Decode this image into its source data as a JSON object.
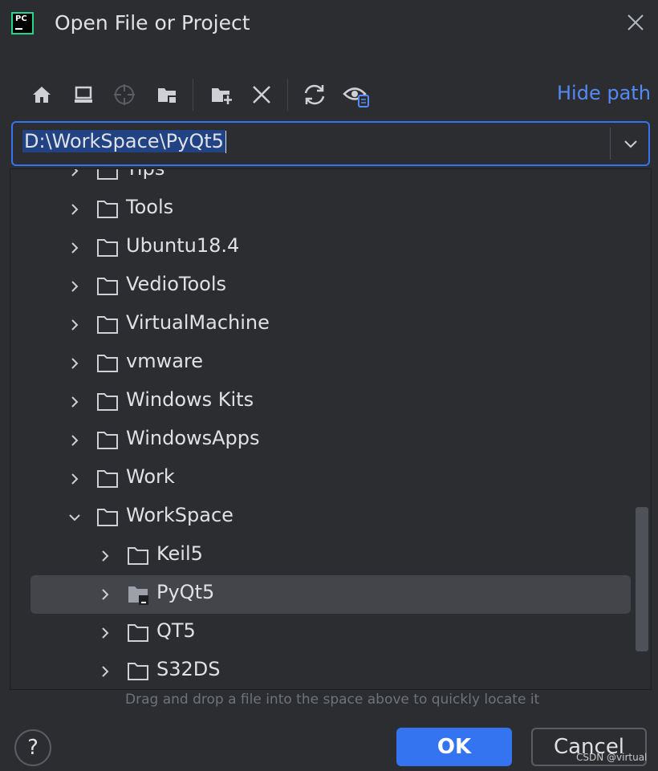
{
  "window": {
    "title": "Open File or Project",
    "app_logo_text": "PC"
  },
  "toolbar": {
    "hide_path_label": "Hide path"
  },
  "path": {
    "value": "D:\\WorkSpace\\PyQt5"
  },
  "tree": {
    "items": [
      {
        "name": "Tips",
        "expanded": false,
        "level": 0
      },
      {
        "name": "Tools",
        "expanded": false,
        "level": 0
      },
      {
        "name": "Ubuntu18.4",
        "expanded": false,
        "level": 0
      },
      {
        "name": "VedioTools",
        "expanded": false,
        "level": 0
      },
      {
        "name": "VirtualMachine",
        "expanded": false,
        "level": 0
      },
      {
        "name": "vmware",
        "expanded": false,
        "level": 0
      },
      {
        "name": "Windows Kits",
        "expanded": false,
        "level": 0
      },
      {
        "name": "WindowsApps",
        "expanded": false,
        "level": 0
      },
      {
        "name": "Work",
        "expanded": false,
        "level": 0
      },
      {
        "name": "WorkSpace",
        "expanded": true,
        "level": 0
      },
      {
        "name": "Keil5",
        "expanded": false,
        "level": 1
      },
      {
        "name": "PyQt5",
        "expanded": false,
        "level": 1,
        "selected": true
      },
      {
        "name": "QT5",
        "expanded": false,
        "level": 1
      },
      {
        "name": "S32DS",
        "expanded": false,
        "level": 1
      }
    ]
  },
  "hint": "Drag and drop a file into the space above to quickly locate it",
  "buttons": {
    "help": "?",
    "ok": "OK",
    "cancel": "Cancel"
  },
  "watermark": "CSDN @virtual",
  "colors": {
    "background": "#2b2d30",
    "accent": "#3574f0",
    "link": "#548af7",
    "selection": "#43454a"
  }
}
